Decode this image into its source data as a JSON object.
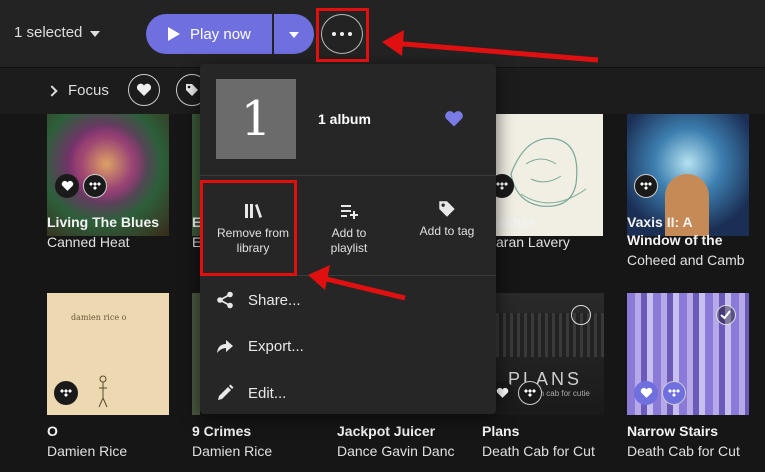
{
  "toolbar": {
    "selected_label": "1 selected",
    "play_label": "Play now"
  },
  "filterbar": {
    "focus_label": "Focus"
  },
  "albums": [
    {
      "title": "Living The Blues",
      "artist": "Canned Heat"
    },
    {
      "title": "E",
      "artist": "E"
    },
    {
      "title": "osher",
      "artist": "aran Lavery"
    },
    {
      "title": "Vaxis II: A",
      "title2": "Window of the",
      "artist": "Coheed and Camb"
    },
    {
      "title": "O",
      "artist": "Damien Rice"
    },
    {
      "title": "9 Crimes",
      "artist": "Damien Rice"
    },
    {
      "title": "Jackpot Juicer",
      "artist": "Dance Gavin Danc"
    },
    {
      "title": "Plans",
      "artist": "Death Cab for Cut",
      "art_text": "PLANS",
      "art_sub": "death cab for cutie"
    },
    {
      "title": "Narrow Stairs",
      "artist": "Death Cab for Cut"
    }
  ],
  "damien_art_text": "damien rice o",
  "menu": {
    "art_number": "1",
    "title": "1 album",
    "actions": [
      {
        "label": "Remove from library"
      },
      {
        "label": "Add to playlist"
      },
      {
        "label": "Add to tag"
      }
    ],
    "items": [
      {
        "label": "Share..."
      },
      {
        "label": "Export..."
      },
      {
        "label": "Edit..."
      }
    ]
  },
  "colors": {
    "accent": "#6f6fe0",
    "annotation": "#e01010"
  }
}
